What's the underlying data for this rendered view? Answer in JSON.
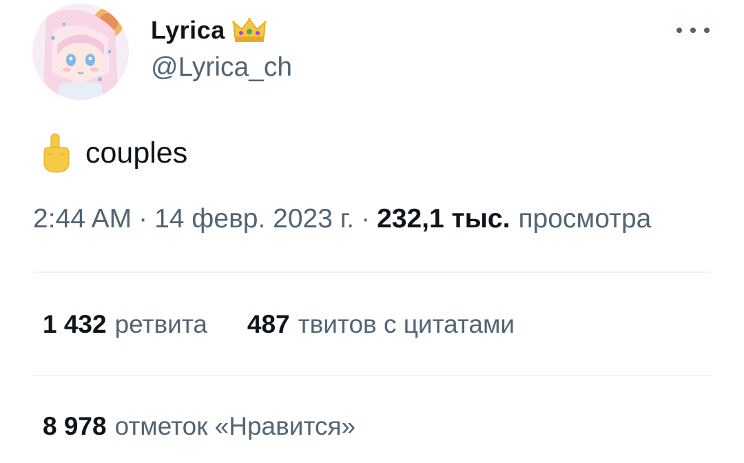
{
  "author": {
    "display_name": "Lyrica",
    "badge_icon": "crown-emoji",
    "handle": "@Lyrica_ch"
  },
  "more_menu_icon": "more-horizontal-icon",
  "tweet": {
    "emoji_icon": "middle-finger-emoji",
    "text": "couples"
  },
  "meta": {
    "time": "2:44 AM",
    "separator": "·",
    "date": "14 февр. 2023 г.",
    "views_count": "232,1 тыс.",
    "views_label": "просмотра"
  },
  "stats": {
    "retweets": {
      "value": "1 432",
      "label": "ретвита"
    },
    "quotes": {
      "value": "487",
      "label": "твитов с цитатами"
    },
    "likes": {
      "value": "8 978",
      "label": "отметок «Нравится»"
    }
  },
  "colors": {
    "text_primary": "#0f1419",
    "text_secondary": "#536471",
    "divider": "#eff3f4"
  }
}
